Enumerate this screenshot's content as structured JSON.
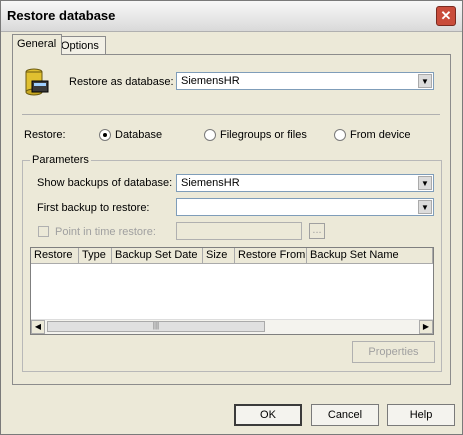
{
  "window": {
    "title": "Restore database"
  },
  "tabs": [
    "General",
    "Options"
  ],
  "restore_as": {
    "label": "Restore as database:",
    "value": "SiemensHR"
  },
  "restore": {
    "label": "Restore:",
    "options": [
      "Database",
      "Filegroups or files",
      "From device"
    ],
    "selected": "Database"
  },
  "parameters": {
    "label": "Parameters",
    "show_backups_label": "Show backups of database:",
    "show_backups_value": "SiemensHR",
    "first_backup_label": "First backup to restore:",
    "first_backup_value": "",
    "point_in_time_label": "Point in time restore:",
    "browse_label": "..."
  },
  "grid": {
    "columns": [
      "Restore",
      "Type",
      "Backup Set Date",
      "Size",
      "Restore From",
      "Backup Set Name"
    ]
  },
  "buttons": {
    "properties": "Properties",
    "ok": "OK",
    "cancel": "Cancel",
    "help": "Help"
  },
  "icons": {
    "close": "close-icon",
    "database": "database-icon"
  }
}
